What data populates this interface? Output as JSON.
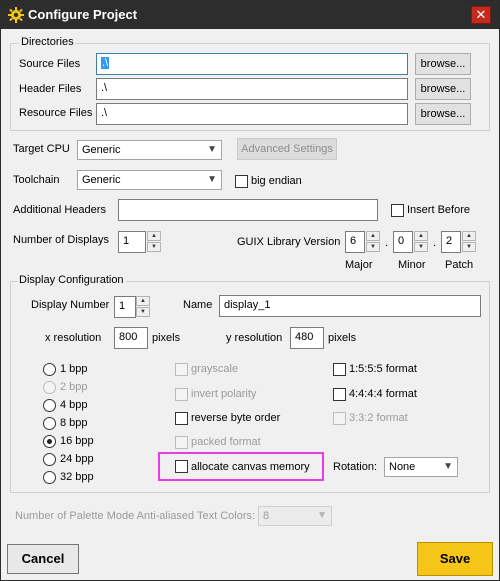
{
  "window": {
    "title": "Configure Project",
    "close_glyph": "✕"
  },
  "directories": {
    "group_label": "Directories",
    "source": {
      "label": "Source Files",
      "value": ".\\"
    },
    "header": {
      "label": "Header Files",
      "value": ".\\"
    },
    "resource": {
      "label": "Resource Files",
      "value": ".\\"
    },
    "browse_label": "browse..."
  },
  "target_cpu": {
    "label": "Target CPU",
    "value": "Generic",
    "advanced_label": "Advanced Settings"
  },
  "toolchain": {
    "label": "Toolchain",
    "value": "Generic",
    "big_endian_label": "big endian"
  },
  "additional_headers": {
    "label": "Additional Headers",
    "value": "",
    "insert_before_label": "Insert Before"
  },
  "num_displays": {
    "label": "Number of Displays",
    "value": "1"
  },
  "guix_version": {
    "label": "GUIX Library Version",
    "major": "6",
    "minor": "0",
    "patch": "2",
    "major_label": "Major",
    "minor_label": "Minor",
    "patch_label": "Patch",
    "dot": "."
  },
  "display_config": {
    "group_label": "Display Configuration",
    "display_number_label": "Display Number",
    "display_number": "1",
    "name_label": "Name",
    "name_value": "display_1",
    "x_res_label": "x resolution",
    "x_res": "800",
    "y_res_label": "y resolution",
    "y_res": "480",
    "pixels_label": "pixels",
    "bpp": [
      {
        "label": "1 bpp",
        "checked": false,
        "disabled": false
      },
      {
        "label": "2 bpp",
        "checked": false,
        "disabled": true
      },
      {
        "label": "4 bpp",
        "checked": false,
        "disabled": false
      },
      {
        "label": "8 bpp",
        "checked": false,
        "disabled": false
      },
      {
        "label": "16 bpp",
        "checked": true,
        "disabled": false
      },
      {
        "label": "24 bpp",
        "checked": false,
        "disabled": false
      },
      {
        "label": "32 bpp",
        "checked": false,
        "disabled": false
      }
    ],
    "options": {
      "grayscale": "grayscale",
      "invert_polarity": "invert polarity",
      "reverse_byte_order": "reverse byte order",
      "packed_format": "packed format",
      "allocate_canvas_memory": "allocate canvas memory"
    },
    "formats": {
      "f1555": "1:5:5:5 format",
      "f4444": "4:4:4:4 format",
      "f332": "3:3:2 format"
    },
    "rotation_label": "Rotation:",
    "rotation_value": "None"
  },
  "palette": {
    "label": "Number of Palette Mode Anti-aliased Text Colors:",
    "value": "8"
  },
  "buttons": {
    "cancel": "Cancel",
    "save": "Save"
  },
  "colors": {
    "titlebar": "#2d2d2d",
    "save": "#f5c518",
    "highlight": "#e83ee0",
    "selection": "#3399ff"
  }
}
